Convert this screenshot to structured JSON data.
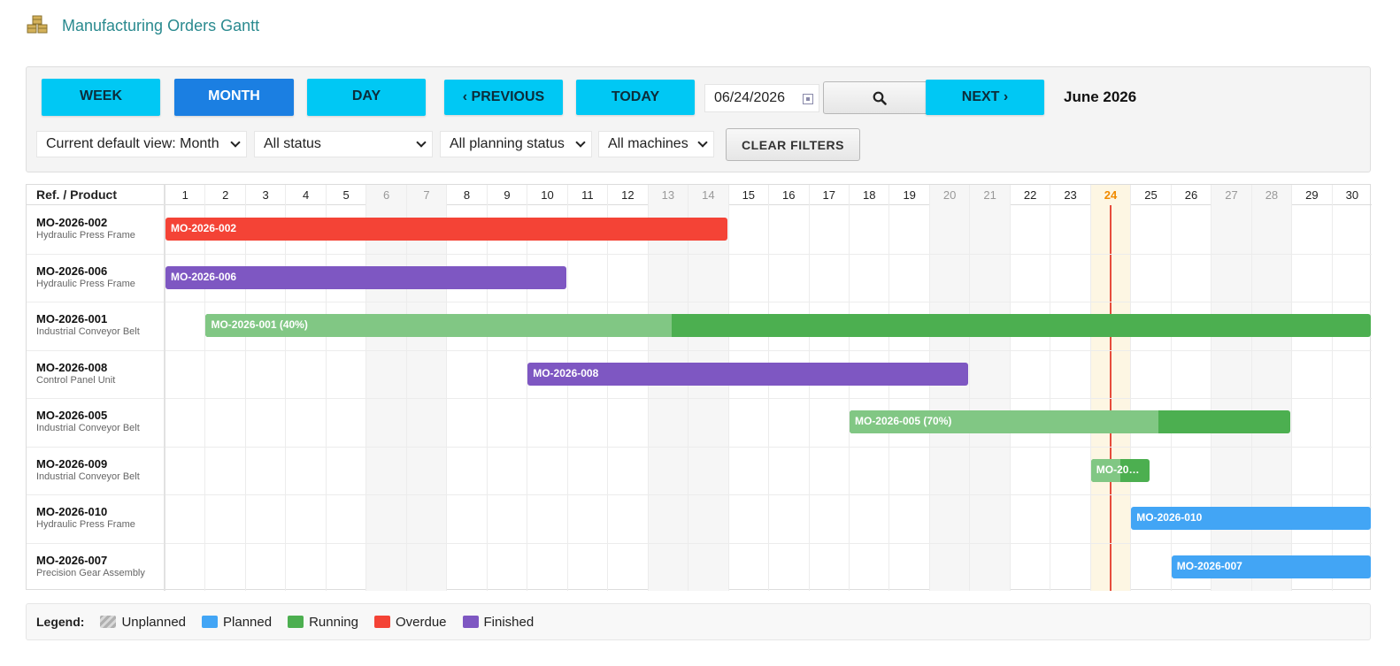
{
  "app": {
    "title": "Manufacturing Orders Gantt",
    "logo_icon": "boxes-icon"
  },
  "toolbar": {
    "week_label": "WEEK",
    "month_label": "MONTH",
    "day_label": "DAY",
    "previous_label": "‹ PREVIOUS",
    "today_label": "TODAY",
    "date_value": "06/24/2026",
    "next_label": "NEXT ›",
    "current_period": "June 2026",
    "active_view": "month"
  },
  "filters": {
    "default_view": "Current default view: Month",
    "status": "All status",
    "planning_status": "All planning status",
    "machines": "All machines",
    "clear_label": "CLEAR FILTERS"
  },
  "gantt": {
    "ref_header": "Ref. / Product",
    "days": [
      1,
      2,
      3,
      4,
      5,
      6,
      7,
      8,
      9,
      10,
      11,
      12,
      13,
      14,
      15,
      16,
      17,
      18,
      19,
      20,
      21,
      22,
      23,
      24,
      25,
      26,
      27,
      28,
      29,
      30
    ],
    "weekend_days": [
      6,
      7,
      13,
      14,
      20,
      21,
      27,
      28
    ],
    "today": 24,
    "rows": [
      {
        "ref": "MO-2026-002",
        "product": "Hydraulic Press Frame",
        "label": "MO-2026-002",
        "status": "overdue",
        "start": 1,
        "end": 14,
        "progress": null
      },
      {
        "ref": "MO-2026-006",
        "product": "Hydraulic Press Frame",
        "label": "MO-2026-006",
        "status": "finished",
        "start": 1,
        "end": 10,
        "progress": null
      },
      {
        "ref": "MO-2026-001",
        "product": "Industrial Conveyor Belt",
        "label": "MO-2026-001 (40%)",
        "status": "running",
        "start": 2,
        "end": 30,
        "progress": 40
      },
      {
        "ref": "MO-2026-008",
        "product": "Control Panel Unit",
        "label": "MO-2026-008",
        "status": "finished",
        "start": 10,
        "end": 20,
        "progress": null
      },
      {
        "ref": "MO-2026-005",
        "product": "Industrial Conveyor Belt",
        "label": "MO-2026-005 (70%)",
        "status": "running",
        "start": 18,
        "end": 28,
        "progress": 70
      },
      {
        "ref": "MO-2026-009",
        "product": "Industrial Conveyor Belt",
        "label": "MO-20…",
        "status": "running",
        "start": 24,
        "end": 24.5,
        "progress": 50
      },
      {
        "ref": "MO-2026-010",
        "product": "Hydraulic Press Frame",
        "label": "MO-2026-010",
        "status": "planned",
        "start": 25,
        "end": 30,
        "progress": null
      },
      {
        "ref": "MO-2026-007",
        "product": "Precision Gear Assembly",
        "label": "MO-2026-007",
        "status": "planned",
        "start": 26,
        "end": 30,
        "progress": null
      }
    ]
  },
  "legend": {
    "title": "Legend:",
    "items": [
      {
        "key": "unplanned",
        "label": "Unplanned"
      },
      {
        "key": "planned",
        "label": "Planned"
      },
      {
        "key": "running",
        "label": "Running"
      },
      {
        "key": "overdue",
        "label": "Overdue"
      },
      {
        "key": "finished",
        "label": "Finished"
      }
    ]
  },
  "colors": {
    "planned": "#42a5f5",
    "running": "#4caf50",
    "running_progress": "#81c784",
    "overdue": "#f44336",
    "finished": "#7e57c2",
    "today_line": "#e74c3c",
    "accent": "#00c8f4",
    "active": "#1b7fe2"
  }
}
